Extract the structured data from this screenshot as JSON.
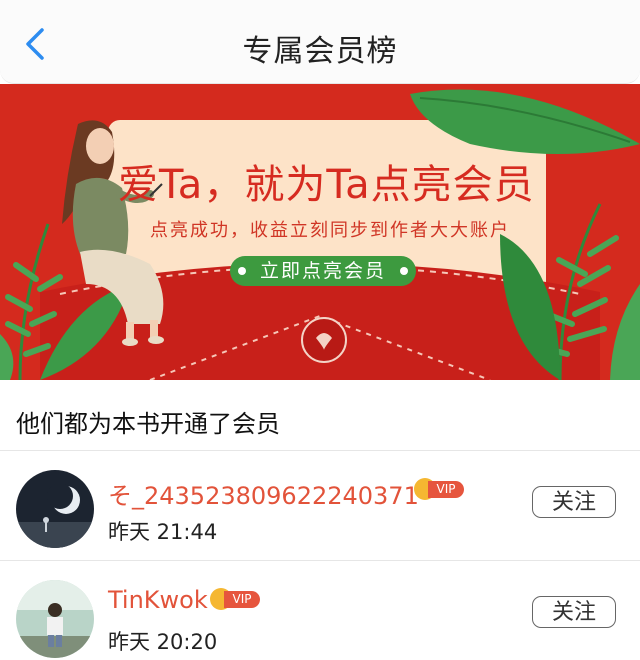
{
  "header": {
    "title": "专属会员榜"
  },
  "banner": {
    "headline": "爱Ta，就为Ta点亮会员",
    "subtitle": "点亮成功，收益立刻同步到作者大大账户",
    "cta_label": "立即点亮会员"
  },
  "section": {
    "title": "他们都为本书开通了会员"
  },
  "members": [
    {
      "name": "そ_2435238096222403​71",
      "badge": "VIP",
      "time": "昨天 21:44",
      "follow_label": "关注"
    },
    {
      "name": "TinKwok",
      "badge": "VIP",
      "time": "昨天 20:20",
      "follow_label": "关注"
    }
  ],
  "colors": {
    "accent_blue": "#2d8cf0",
    "banner_red": "#d42a1e",
    "card_cream": "#fde3c8",
    "cta_green": "#3d9a3f",
    "username_red": "#e2533a",
    "vip_gold": "#f5b731"
  }
}
